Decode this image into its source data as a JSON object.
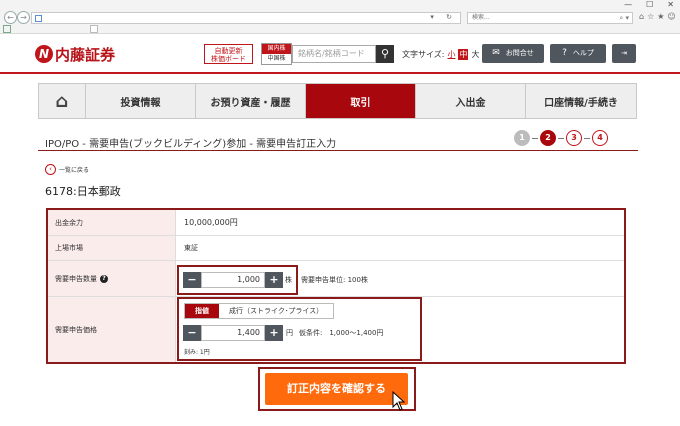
{
  "browser": {
    "window_controls": [
      "—",
      "☐",
      "✕"
    ],
    "search_placeholder": "検索...",
    "search_icon": "search-icon",
    "toolbar_icons": [
      "home-icon",
      "star-icon",
      "gear-icon",
      "smiley-icon"
    ]
  },
  "header": {
    "logo_mark": "N",
    "logo_text": "内藤証券",
    "auto_board_line1": "自動更新",
    "auto_board_line2": "株価ボード",
    "market_on": "国内株",
    "market_off": "中国株",
    "code_placeholder": "銘柄名/銘柄コード",
    "font_size_label": "文字サイズ:",
    "font_small": "小",
    "font_medium": "中",
    "font_large": "大",
    "contact_label": "お問合せ",
    "help_label": "ヘルプ",
    "accent_color": "#c0151b"
  },
  "nav": {
    "items": [
      "投資情報",
      "お預り資産・履歴",
      "取引",
      "入出金",
      "口座情報/手続き"
    ],
    "active": "取引"
  },
  "page": {
    "title": "IPO/PO - 需要申告(ブックビルディング)参加 - 需要申告訂正入力",
    "steps": [
      "1",
      "2",
      "3",
      "4"
    ],
    "current_step": "2",
    "back_label": "一覧に戻る",
    "stock": "6178:日本郵政"
  },
  "form": {
    "balance_label": "出金余力",
    "balance_value": "10,000,000円",
    "market_label": "上場市場",
    "market_value": "東証",
    "qty_label": "需要申告数量",
    "qty_value": "1,000",
    "qty_unit": "株",
    "qty_note": "需要申告単位: 100株",
    "price_label": "需要申告価格",
    "price_tab_limit": "指値",
    "price_tab_market": "成行（ストライク･プライス）",
    "price_value": "1,400",
    "price_unit": "円",
    "price_condition": "仮条件:　1,000～1,400円",
    "tick_note": "刻み: 1円",
    "confirm_label": "訂正内容を確認する",
    "confirm_color": "#ff6a0d"
  }
}
